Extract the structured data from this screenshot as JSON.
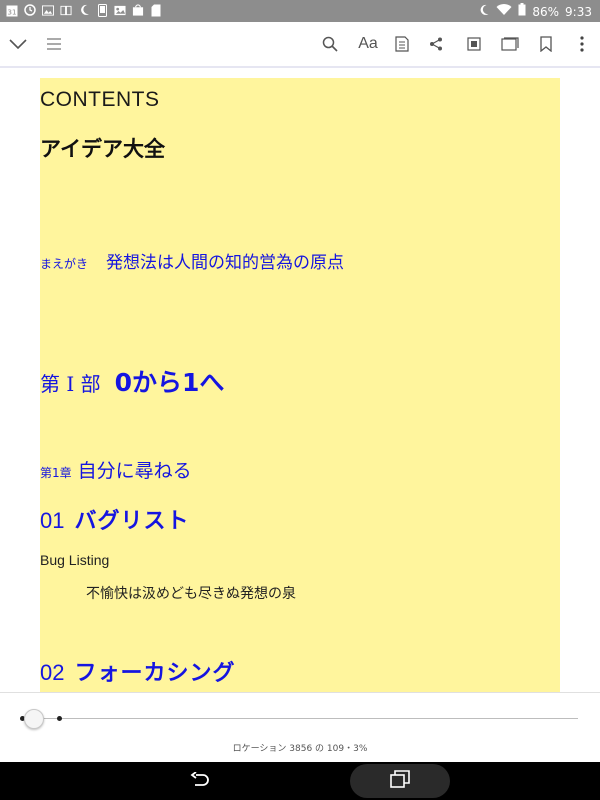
{
  "status_bar": {
    "left_icons": [
      "calendar-icon",
      "clock-icon",
      "gallery-icon",
      "book-icon",
      "moon-icon",
      "phone-icon",
      "image-icon",
      "store-icon",
      "sd-card-icon"
    ],
    "calendar_day": "31",
    "battery": "86%",
    "time": "9:33"
  },
  "toolbar": {
    "font_button": "Aa"
  },
  "page": {
    "contents_heading": "CONTENTS",
    "book_title": "アイデア大全",
    "preface_label": "まえがき",
    "preface_title": "発想法は人間の知的営為の原点",
    "part_label": "第 I 部",
    "part_title": "0から1へ",
    "chapter_label": "第1章",
    "chapter_title": "自分に尋ねる",
    "sections": [
      {
        "number": "01",
        "title": "バグリスト",
        "english": "Bug Listing",
        "subtitle": "不愉快は汲めども尽きぬ発想の泉"
      },
      {
        "number": "02",
        "title": "フォーカシング"
      }
    ]
  },
  "progress": {
    "location_text": "ロケーション 3856 の 109・3%",
    "fraction": 0.03
  },
  "colors": {
    "highlight": "#fff59d",
    "link": "#1515e0"
  }
}
